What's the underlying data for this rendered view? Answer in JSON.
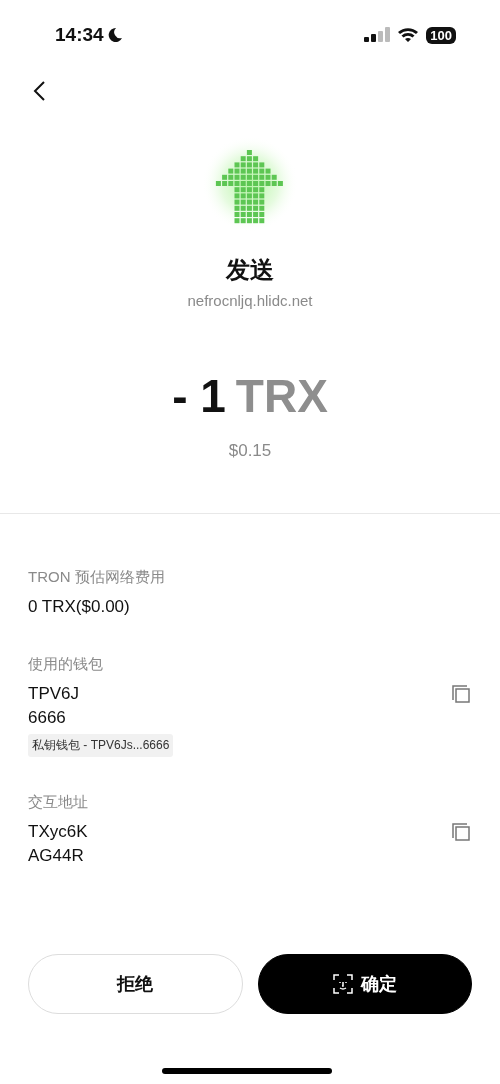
{
  "status_bar": {
    "time": "14:34",
    "battery": "100"
  },
  "header": {
    "title": "发送",
    "domain": "nefrocnljq.hlidc.net"
  },
  "amount": {
    "value": "- 1",
    "unit": "TRX",
    "fiat": "$0.15"
  },
  "details": [
    {
      "label": "TRON 预估网络费用",
      "lines": [
        "0 TRX($0.00)"
      ],
      "copyable": false
    },
    {
      "label": "使用的钱包",
      "lines": [
        "TPV6J",
        "6666"
      ],
      "tag": "私钥钱包 - TPV6Js...6666",
      "copyable": true
    },
    {
      "label": "交互地址",
      "lines": [
        "TXyc6K",
        "AG44R"
      ],
      "copyable": true
    }
  ],
  "buttons": [
    {
      "label": "拒绝",
      "kind": "secondary"
    },
    {
      "label": "确定",
      "kind": "primary"
    }
  ]
}
